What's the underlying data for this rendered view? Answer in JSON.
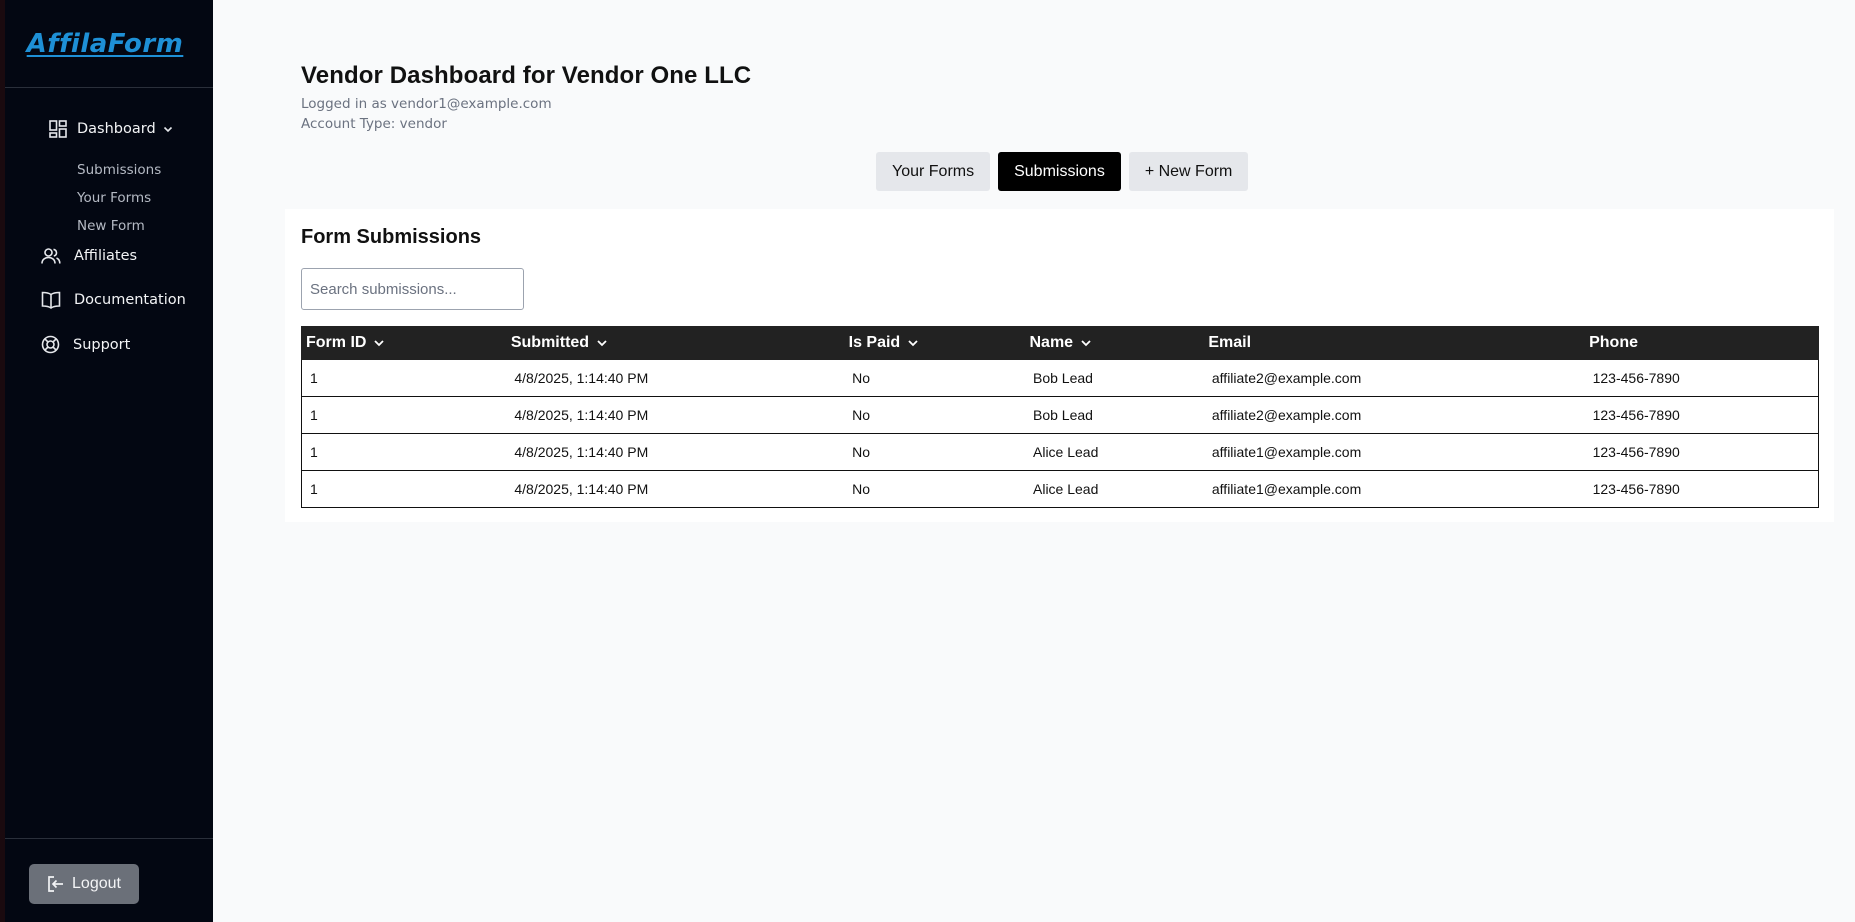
{
  "app": {
    "logo": "AffilaForm"
  },
  "sidebar": {
    "dashboard": {
      "label": "Dashboard",
      "icon": "dashboard-grid-icon"
    },
    "subitems": [
      {
        "label": "Submissions"
      },
      {
        "label": "Your Forms"
      },
      {
        "label": "New Form"
      }
    ],
    "items": [
      {
        "label": "Affiliates",
        "icon": "users-icon"
      },
      {
        "label": "Documentation",
        "icon": "book-icon"
      },
      {
        "label": "Support",
        "icon": "lifebuoy-icon"
      }
    ],
    "logout_label": "Logout"
  },
  "header": {
    "title": "Vendor Dashboard for Vendor One LLC",
    "logged_in": "Logged in as vendor1@example.com",
    "account_type": "Account Type: vendor"
  },
  "tabs": [
    {
      "label": "Your Forms",
      "active": false
    },
    {
      "label": "Submissions",
      "active": true
    },
    {
      "label": "+ New Form",
      "active": false
    }
  ],
  "submissions": {
    "title": "Form Submissions",
    "search_placeholder": "Search submissions...",
    "columns": [
      {
        "label": "Form ID",
        "sortable": true
      },
      {
        "label": "Submitted",
        "sortable": true
      },
      {
        "label": "Is Paid",
        "sortable": true
      },
      {
        "label": "Name",
        "sortable": true
      },
      {
        "label": "Email",
        "sortable": false
      },
      {
        "label": "Phone",
        "sortable": false
      }
    ],
    "rows": [
      [
        "1",
        "4/8/2025, 1:14:40 PM",
        "No",
        "Bob Lead",
        "affiliate2@example.com",
        "123-456-7890"
      ],
      [
        "1",
        "4/8/2025, 1:14:40 PM",
        "No",
        "Bob Lead",
        "affiliate2@example.com",
        "123-456-7890"
      ],
      [
        "1",
        "4/8/2025, 1:14:40 PM",
        "No",
        "Alice Lead",
        "affiliate1@example.com",
        "123-456-7890"
      ],
      [
        "1",
        "4/8/2025, 1:14:40 PM",
        "No",
        "Alice Lead",
        "affiliate1@example.com",
        "123-456-7890"
      ]
    ]
  },
  "colors": {
    "sidebar_bg": "#030712",
    "logo": "#1e90d6",
    "active_tab": "#000000",
    "table_header": "#222222"
  }
}
